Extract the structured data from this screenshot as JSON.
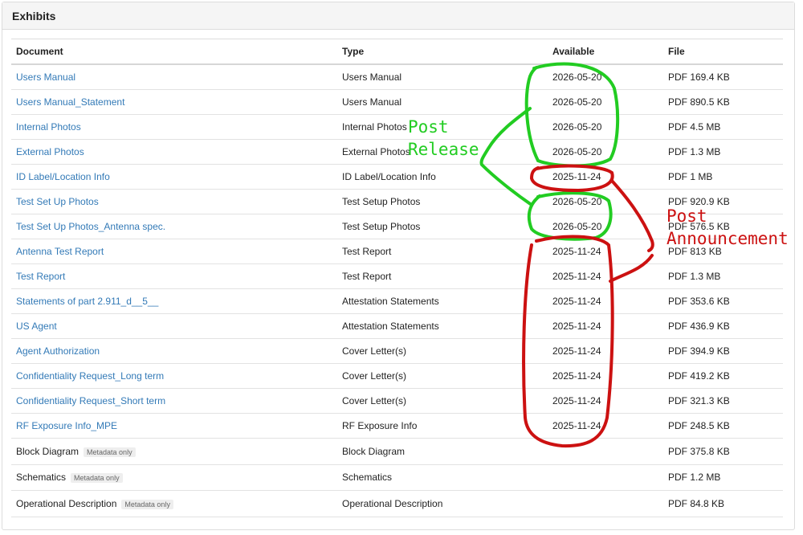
{
  "panel": {
    "title": "Exhibits"
  },
  "table": {
    "headers": [
      "Document",
      "Type",
      "Available",
      "File"
    ],
    "rows": [
      {
        "document": "Users Manual",
        "type": "Users Manual",
        "available": "2026-05-20",
        "file": "PDF 169.4 KB",
        "link": true
      },
      {
        "document": "Users Manual_Statement",
        "type": "Users Manual",
        "available": "2026-05-20",
        "file": "PDF 890.5 KB",
        "link": true
      },
      {
        "document": "Internal Photos",
        "type": "Internal Photos",
        "available": "2026-05-20",
        "file": "PDF 4.5 MB",
        "link": true
      },
      {
        "document": "External Photos",
        "type": "External Photos",
        "available": "2026-05-20",
        "file": "PDF 1.3 MB",
        "link": true
      },
      {
        "document": "ID Label/Location Info",
        "type": "ID Label/Location Info",
        "available": "2025-11-24",
        "file": "PDF 1 MB",
        "link": true
      },
      {
        "document": "Test Set Up Photos",
        "type": "Test Setup Photos",
        "available": "2026-05-20",
        "file": "PDF 920.9 KB",
        "link": true
      },
      {
        "document": "Test Set Up Photos_Antenna spec.",
        "type": "Test Setup Photos",
        "available": "2026-05-20",
        "file": "PDF 576.5 KB",
        "link": true
      },
      {
        "document": "Antenna Test Report",
        "type": "Test Report",
        "available": "2025-11-24",
        "file": "PDF 813 KB",
        "link": true
      },
      {
        "document": "Test Report",
        "type": "Test Report",
        "available": "2025-11-24",
        "file": "PDF 1.3 MB",
        "link": true
      },
      {
        "document": "Statements of part 2.911_d__5__",
        "type": "Attestation Statements",
        "available": "2025-11-24",
        "file": "PDF 353.6 KB",
        "link": true
      },
      {
        "document": "US Agent",
        "type": "Attestation Statements",
        "available": "2025-11-24",
        "file": "PDF 436.9 KB",
        "link": true
      },
      {
        "document": "Agent Authorization",
        "type": "Cover Letter(s)",
        "available": "2025-11-24",
        "file": "PDF 394.9 KB",
        "link": true
      },
      {
        "document": "Confidentiality Request_Long term",
        "type": "Cover Letter(s)",
        "available": "2025-11-24",
        "file": "PDF 419.2 KB",
        "link": true
      },
      {
        "document": "Confidentiality Request_Short term",
        "type": "Cover Letter(s)",
        "available": "2025-11-24",
        "file": "PDF 321.3 KB",
        "link": true
      },
      {
        "document": "RF Exposure Info_MPE",
        "type": "RF Exposure Info",
        "available": "2025-11-24",
        "file": "PDF 248.5 KB",
        "link": true
      },
      {
        "document": "Block Diagram",
        "badge": "Metadata only",
        "type": "Block Diagram",
        "available": "",
        "file": "PDF 375.8 KB",
        "link": false
      },
      {
        "document": "Schematics",
        "badge": "Metadata only",
        "type": "Schematics",
        "available": "",
        "file": "PDF 1.2 MB",
        "link": false
      },
      {
        "document": "Operational Description",
        "badge": "Metadata only",
        "type": "Operational Description",
        "available": "",
        "file": "PDF 84.8 KB",
        "link": false
      }
    ]
  },
  "annotations": {
    "green_label_line1": "Post",
    "green_label_line2": "Release",
    "red_label_line1": "Post",
    "red_label_line2": "Announcement",
    "green_color": "#22cc22",
    "red_color": "#cc1111"
  }
}
